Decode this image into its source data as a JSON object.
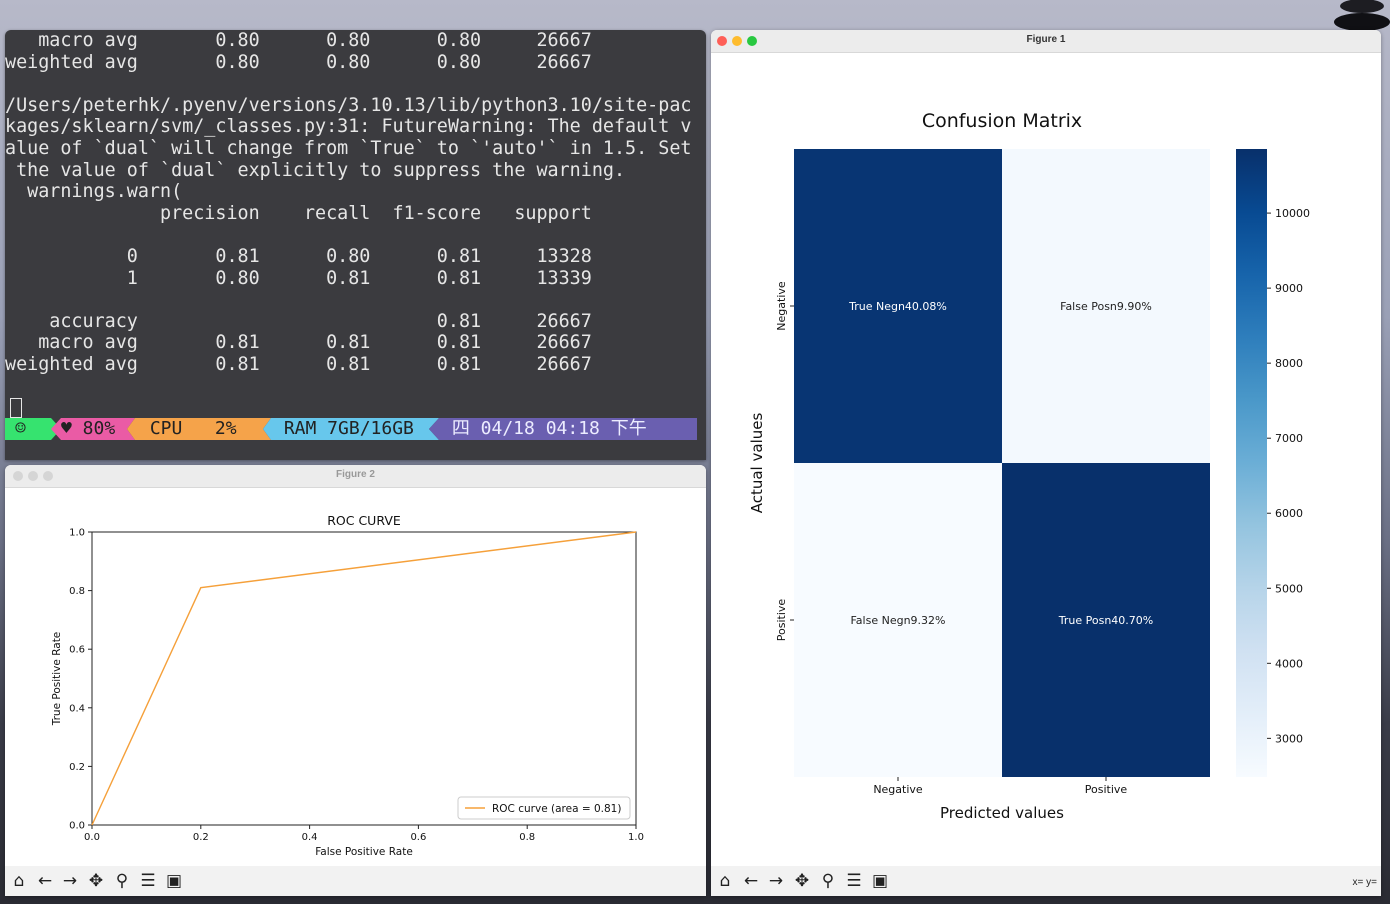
{
  "terminal": {
    "lines": [
      "   macro avg       0.80      0.80      0.80     26667",
      "weighted avg       0.80      0.80      0.80     26667",
      "",
      "/Users/peterhk/.pyenv/versions/3.10.13/lib/python3.10/site-pac",
      "kages/sklearn/svm/_classes.py:31: FutureWarning: The default v",
      "alue of `dual` will change from `True` to `'auto'` in 1.5. Set",
      " the value of `dual` explicitly to suppress the warning.",
      "  warnings.warn(",
      "              precision    recall  f1-score   support",
      "",
      "           0       0.81      0.80      0.81     13328",
      "           1       0.80      0.81      0.81     13339",
      "",
      "    accuracy                           0.81     26667",
      "   macro avg       0.81      0.81      0.81     26667",
      "weighted avg       0.81      0.81      0.81     26667"
    ],
    "status": {
      "smile": "☺",
      "battery": "♥ 80%",
      "cpu": " CPU   2%",
      "ram": " RAM 7GB/16GB",
      "datetime": " 四 04/18 04:18 下午",
      "colors": {
        "smile": "#36e36f",
        "battery": "#ea5ba5",
        "cpu": "#f5a34a",
        "ram": "#67c7ec",
        "datetime": "#6a5fb0"
      }
    }
  },
  "figure2": {
    "window_title": "Figure 2",
    "toolbar_icons": [
      "home-icon",
      "back-arrow-icon",
      "forward-arrow-icon",
      "pan-icon",
      "zoom-icon",
      "configure-icon",
      "save-icon"
    ],
    "chart_data": {
      "type": "line",
      "title": "ROC CURVE",
      "xlabel": "False Positive Rate",
      "ylabel": "True Positive Rate",
      "xlim": [
        0.0,
        1.0
      ],
      "ylim": [
        0.0,
        1.0
      ],
      "xticks": [
        "0.0",
        "0.2",
        "0.4",
        "0.6",
        "0.8",
        "1.0"
      ],
      "yticks": [
        "0.0",
        "0.2",
        "0.4",
        "0.6",
        "0.8",
        "1.0"
      ],
      "grid": false,
      "legend": "lower right",
      "series": [
        {
          "name": "ROC curve (area = 0.81)",
          "color": "#f5a03a",
          "x": [
            0.0,
            0.2,
            1.0
          ],
          "y": [
            0.0,
            0.81,
            1.0
          ]
        }
      ]
    }
  },
  "figure1": {
    "window_title": "Figure 1",
    "coords": "x= y=",
    "toolbar_icons": [
      "home-icon",
      "back-arrow-icon",
      "forward-arrow-icon",
      "pan-icon",
      "zoom-icon",
      "configure-icon",
      "save-icon"
    ],
    "chart_data": {
      "type": "heatmap",
      "title": "Confusion Matrix",
      "xlabel": "Predicted values",
      "ylabel": "Actual values",
      "x_categories": [
        "Negative",
        "Positive"
      ],
      "y_categories": [
        "Negative",
        "Positive"
      ],
      "cell_labels": [
        [
          "True Negn40.08%",
          "False Posn9.90%"
        ],
        [
          "False Negn9.32%",
          "True Posn40.70%"
        ]
      ],
      "values": [
        [
          10690,
          2640
        ],
        [
          2485,
          10854
        ]
      ],
      "colorbar": {
        "range": [
          2485,
          10854
        ],
        "ticks": [
          3000,
          4000,
          5000,
          6000,
          7000,
          8000,
          9000,
          10000
        ],
        "colormap": "Blues",
        "low_color": "#f7fbff",
        "high_color": "#08306b"
      }
    }
  }
}
